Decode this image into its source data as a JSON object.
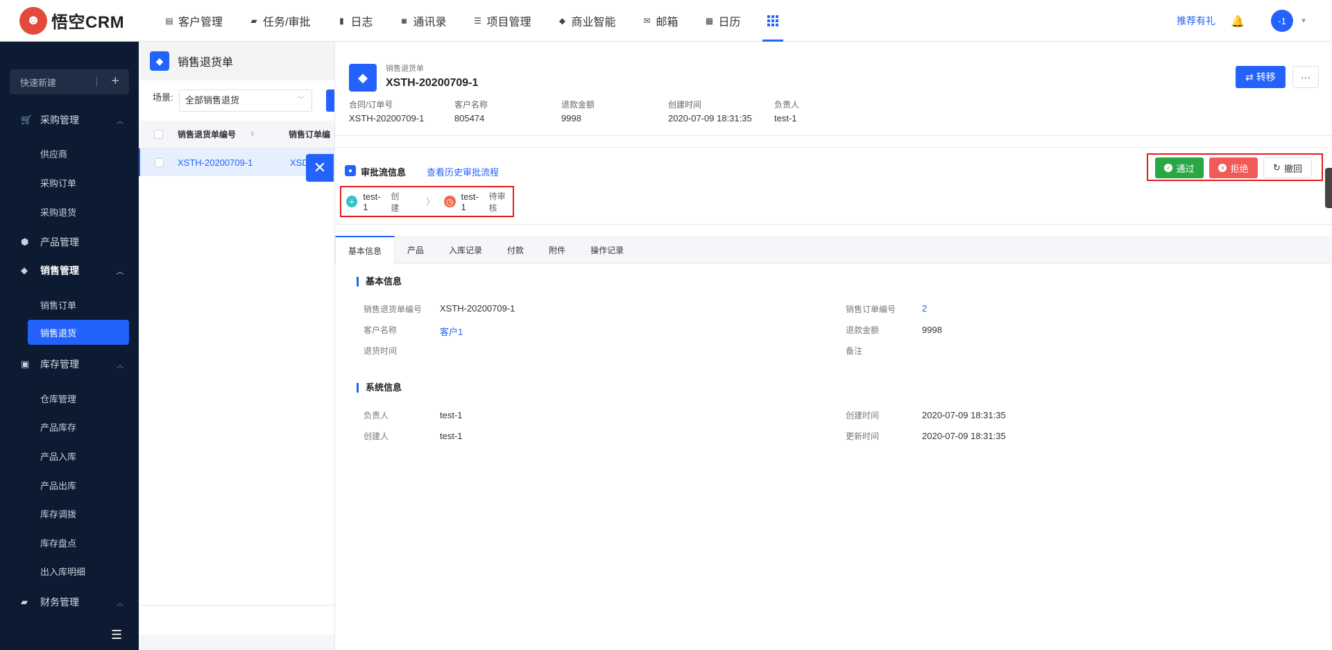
{
  "brand": {
    "name": "悟空CRM",
    "logo_icon": "monkey-logo"
  },
  "nav": {
    "items": [
      {
        "label": "客户管理",
        "icon": "building-icon"
      },
      {
        "label": "任务/审批",
        "icon": "briefcase-icon"
      },
      {
        "label": "日志",
        "icon": "notebook-icon"
      },
      {
        "label": "通讯录",
        "icon": "phone-book-icon"
      },
      {
        "label": "项目管理",
        "icon": "list-icon"
      },
      {
        "label": "商业智能",
        "icon": "shield-icon"
      },
      {
        "label": "邮箱",
        "icon": "mail-icon"
      },
      {
        "label": "日历",
        "icon": "calendar-icon"
      }
    ],
    "apps_icon": "grid-icon",
    "recommend": "推荐有礼",
    "avatar": "-1"
  },
  "sidebar": {
    "quick_new": "快速新建",
    "groups": [
      {
        "label": "采购管理",
        "items": [
          "供应商",
          "采购订单",
          "采购退货"
        ]
      },
      {
        "label": "产品管理",
        "items": []
      },
      {
        "label": "销售管理",
        "items": [
          "销售订单",
          "销售退货"
        ],
        "active_item": "销售退货"
      },
      {
        "label": "库存管理",
        "items": [
          "仓库管理",
          "产品库存",
          "产品入库",
          "产品出库",
          "库存调拨",
          "库存盘点",
          "出入库明细"
        ]
      },
      {
        "label": "财务管理",
        "items": []
      }
    ]
  },
  "list": {
    "title": "销售退货单",
    "scene_label": "场景:",
    "scene_value": "全部销售退货",
    "columns": [
      "销售退货单编号",
      "销售订单编"
    ],
    "rows": [
      {
        "code": "XSTH-20200709-1",
        "order": "XSD"
      }
    ]
  },
  "detail": {
    "subtitle": "销售退货单",
    "title": "XSTH-20200709-1",
    "transfer_label": "转移",
    "more_label": "···",
    "meta": [
      {
        "label": "合同/订单号",
        "value": "XSTH-20200709-1"
      },
      {
        "label": "客户名称",
        "value": "805474"
      },
      {
        "label": "退款金额",
        "value": "9998"
      },
      {
        "label": "创建时间",
        "value": "2020-07-09 18:31:35"
      },
      {
        "label": "负责人",
        "value": "test-1"
      }
    ],
    "approval": {
      "title": "审批流信息",
      "history_link": "查看历史审批流程",
      "steps": [
        {
          "user": "test-1",
          "state": "创建",
          "color": "#36c2c8"
        },
        {
          "user": "test-1",
          "state": "待审核",
          "color": "#f06a4d"
        }
      ],
      "pass": "通过",
      "reject": "拒绝",
      "revoke": "撤回"
    },
    "tabs": [
      "基本信息",
      "产品",
      "入库记录",
      "付款",
      "附件",
      "操作记录"
    ],
    "basic": {
      "title": "基本信息",
      "left": [
        {
          "label": "销售退货单编号",
          "value": "XSTH-20200709-1"
        },
        {
          "label": "客户名称",
          "value": "客户1"
        },
        {
          "label": "退货时间",
          "value": ""
        }
      ],
      "right": [
        {
          "label": "销售订单编号",
          "value": "2"
        },
        {
          "label": "退款金额",
          "value": "9998"
        },
        {
          "label": "备注",
          "value": ""
        }
      ]
    },
    "system": {
      "title": "系统信息",
      "left": [
        {
          "label": "负责人",
          "value": "test-1"
        },
        {
          "label": "创建人",
          "value": "test-1"
        }
      ],
      "right": [
        {
          "label": "创建时间",
          "value": "2020-07-09 18:31:35"
        },
        {
          "label": "更新时间",
          "value": "2020-07-09 18:31:35"
        }
      ]
    }
  },
  "colors": {
    "primary": "#2362fb",
    "sidebar_bg": "#0c1b32",
    "pass": "#28a745",
    "reject": "#f25a5a",
    "highlight_box": "#e61919"
  }
}
